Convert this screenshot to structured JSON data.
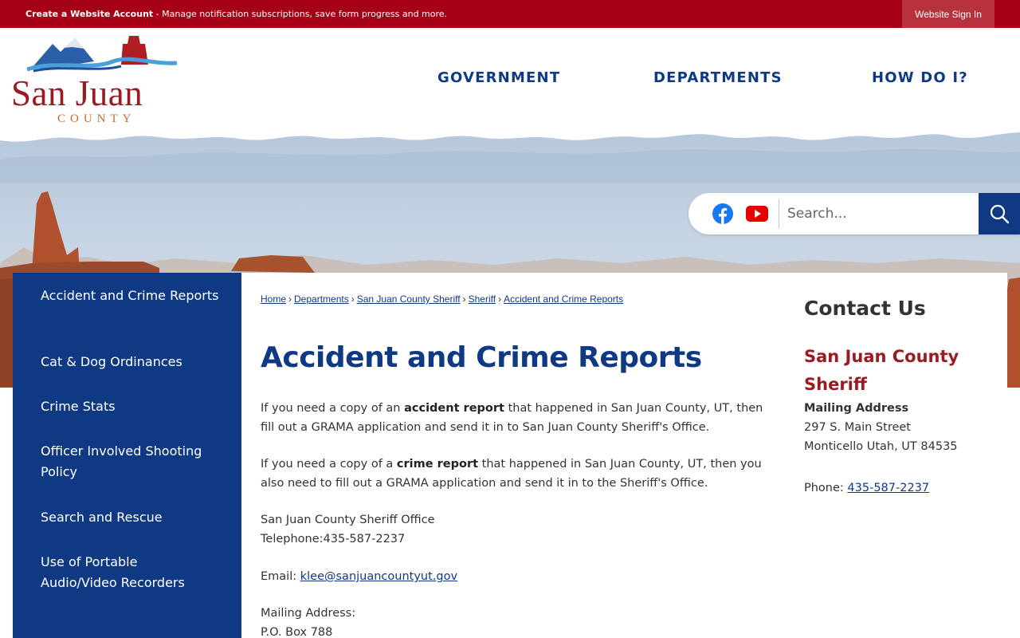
{
  "topbar": {
    "account_link": "Create a Website Account",
    "message": " - Manage notification subscriptions, save form progress and more.",
    "signin": "Website Sign In"
  },
  "logo": {
    "name": "San Juan",
    "county": "COUNTY"
  },
  "nav": [
    {
      "label": "GOVERNMENT"
    },
    {
      "label": "DEPARTMENTS"
    },
    {
      "label": "HOW DO I?"
    }
  ],
  "search": {
    "placeholder": "Search..."
  },
  "icons": {
    "facebook": "facebook-icon",
    "youtube": "youtube-icon",
    "search": "search-icon"
  },
  "colors": {
    "brand_blue": "#0f3a83",
    "brand_red": "#a50016",
    "facebook": "#1877f2",
    "youtube": "#e60000"
  },
  "sidebar": {
    "items": [
      {
        "label": "Accident and Crime Reports"
      },
      {
        "label": "Cat & Dog Ordinances"
      },
      {
        "label": "Crime Stats"
      },
      {
        "label": "Officer Involved Shooting Policy"
      },
      {
        "label": "Search and Rescue"
      },
      {
        "label": "Use of Portable Audio/Video Recorders"
      }
    ]
  },
  "breadcrumb": [
    {
      "label": "Home"
    },
    {
      "label": "Departments"
    },
    {
      "label": "San Juan County Sheriff"
    },
    {
      "label": "Sheriff"
    },
    {
      "label": "Accident and Crime Reports"
    }
  ],
  "page": {
    "title": "Accident and Crime Reports",
    "p1_pre": "If you need a copy of an ",
    "p1_bold": "accident report",
    "p1_post": " that happened in San Juan County, UT, then fill out a GRAMA application and send it in to San Juan County Sheriff's Office.",
    "p2_pre": "If you need a copy of a ",
    "p2_bold": "crime report",
    "p2_post": " that happened in San Juan County, UT, then you also need to fill out a GRAMA application and send it in to the Sheriff's Office.",
    "office_name": "San Juan County Sheriff Office",
    "telephone": "Telephone:435-587-2237",
    "email_label": "Email: ",
    "email": "klee@sanjuancountyut.gov",
    "mailing_label": "Mailing Address:",
    "po_box": "P.O. Box 788"
  },
  "contact": {
    "heading": "Contact Us",
    "org": "San Juan County Sheriff",
    "mailing_label": "Mailing Address",
    "street": "297 S. Main Street",
    "city": "Monticello Utah, UT 84535",
    "phone_label": "Phone: ",
    "phone": "435-587-2237"
  }
}
